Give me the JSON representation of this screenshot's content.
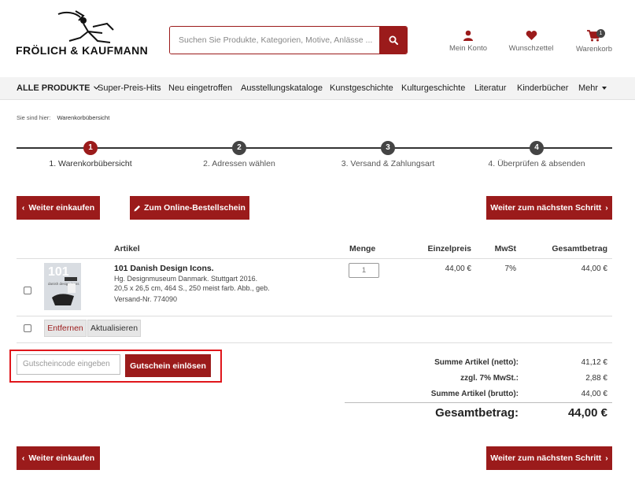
{
  "header": {
    "logo_text": "FRÖLICH & KAUFMANN",
    "search_placeholder": "Suchen Sie Produkte, Kategorien, Motive, Anlässe ...",
    "account_label": "Mein Konto",
    "wishlist_label": "Wunschzettel",
    "cart_label": "Warenkorb",
    "cart_count": "1"
  },
  "nav": {
    "items": [
      "ALLE PRODUKTE",
      "Super-Preis-Hits",
      "Neu eingetroffen",
      "Ausstellungskataloge",
      "Kunstgeschichte",
      "Kulturgeschichte",
      "Literatur",
      "Kinderbücher",
      "Mehr"
    ]
  },
  "breadcrumb": {
    "prefix": "Sie sind hier:",
    "current": "Warenkorbübersicht"
  },
  "steps": [
    {
      "number": "1",
      "label": "1. Warenkorbübersicht",
      "active": true
    },
    {
      "number": "2",
      "label": "2. Adressen wählen",
      "active": false
    },
    {
      "number": "3",
      "label": "3. Versand & Zahlungsart",
      "active": false
    },
    {
      "number": "4",
      "label": "4. Überprüfen & absenden",
      "active": false
    }
  ],
  "buttons": {
    "continue_shopping": "Weiter einkaufen",
    "online_order_form": "Zum Online-Bestellschein",
    "next_step": "Weiter zum nächsten Schritt",
    "remove": "Entfernen",
    "update": "Aktualisieren",
    "redeem_voucher": "Gutschein einlösen"
  },
  "table": {
    "headers": {
      "article": "Artikel",
      "quantity": "Menge",
      "unit_price": "Einzelpreis",
      "vat": "MwSt",
      "total": "Gesamtbetrag"
    },
    "items": [
      {
        "title": "101 Danish Design Icons.",
        "line1": "Hg. Designmuseum Danmark. Stuttgart 2016.",
        "line2": "20,5 x 26,5 cm, 464 S., 250 meist farb. Abb., geb.",
        "article_no": "Versand-Nr. 774090",
        "quantity": "1",
        "unit_price": "44,00 €",
        "vat": "7%",
        "total": "44,00 €",
        "cover_number": "101",
        "cover_text": "danish design icons"
      }
    ]
  },
  "voucher": {
    "placeholder": "Gutscheincode eingeben"
  },
  "summary": {
    "net_label": "Summe Artikel (netto):",
    "net_value": "41,12 €",
    "vat_label": "zzgl. 7% MwSt.:",
    "vat_value": "2,88 €",
    "gross_label": "Summe Artikel (brutto):",
    "gross_value": "44,00 €",
    "total_label": "Gesamtbetrag:",
    "total_value": "44,00 €"
  },
  "colors": {
    "brand_red": "#9b1b1b",
    "highlight_red": "#e0161b",
    "step_gray": "#444444"
  }
}
